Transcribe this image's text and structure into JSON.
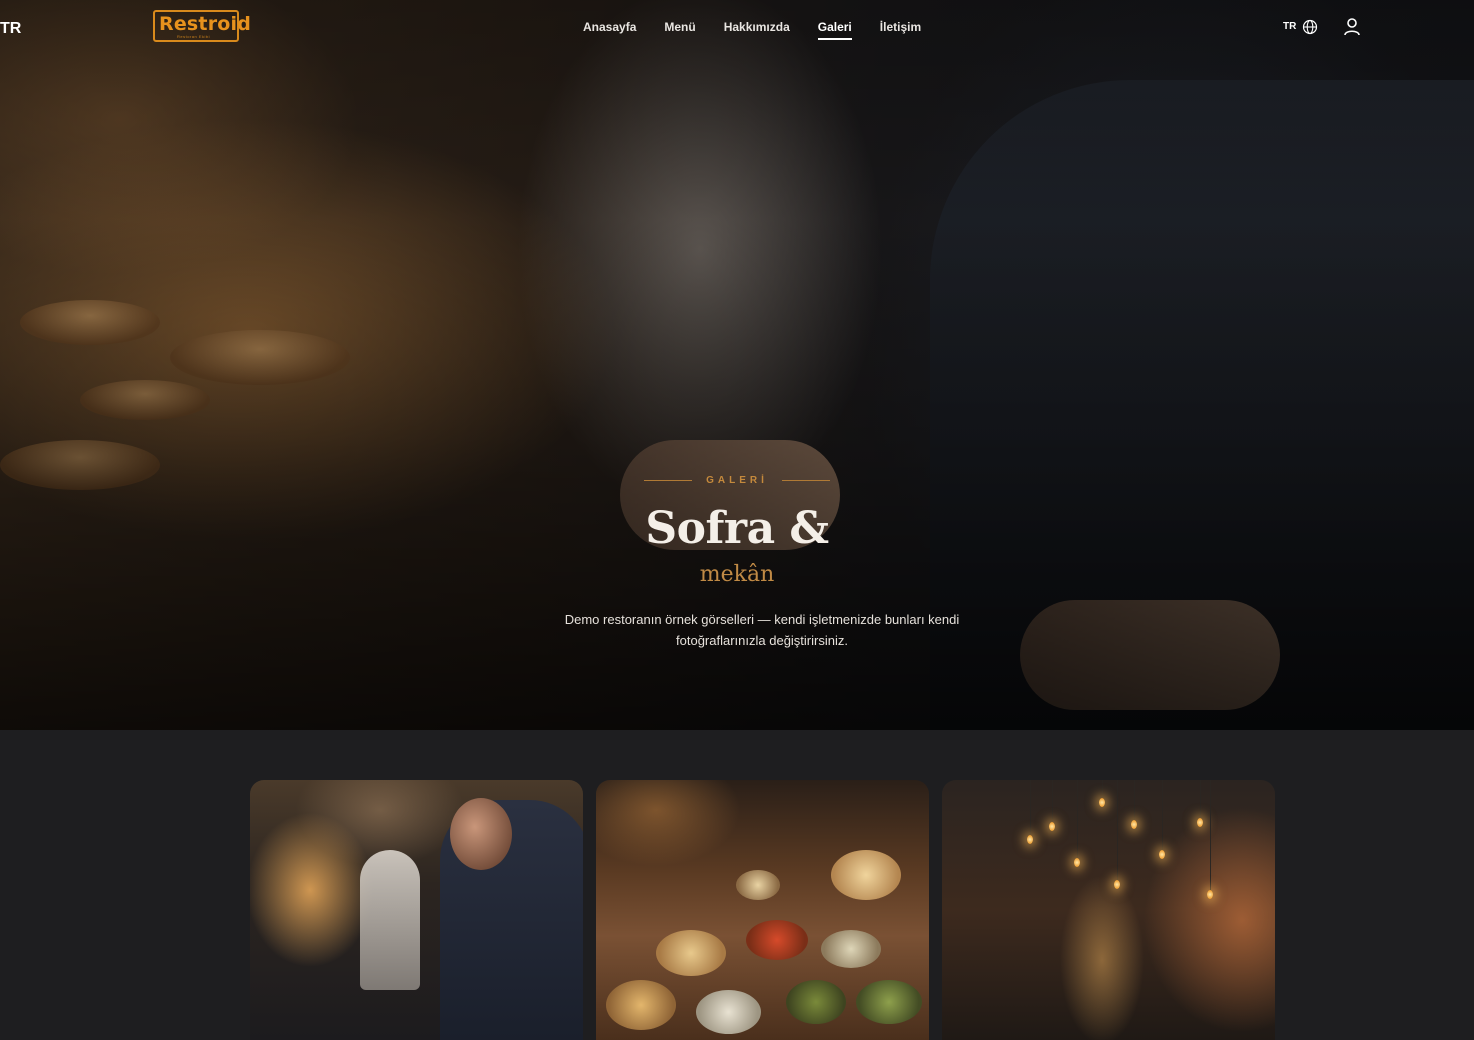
{
  "brand": {
    "name": "Restroid",
    "tagline": "Restoran Ekibi"
  },
  "nav": {
    "items": [
      {
        "label": "Anasayfa",
        "active": false
      },
      {
        "label": "Menü",
        "active": false
      },
      {
        "label": "Hakkımızda",
        "active": false
      },
      {
        "label": "Galeri",
        "active": true
      },
      {
        "label": "İletişim",
        "active": false
      }
    ],
    "lang_flag": "TR",
    "lang_label": "TR",
    "globe_icon": "globe-icon",
    "user_icon": "user-icon"
  },
  "hero": {
    "eyebrow": "GALERİ",
    "title": "Sofra &",
    "subtitle": "mekân",
    "description": "Demo restoranın örnek görselleri — kendi işletmenizde bunları kendi fotoğraflarınızla değiştirirsiniz."
  },
  "gallery": {
    "items": [
      {
        "alt": "kitchen-chef-photo"
      },
      {
        "alt": "table-meze-photo"
      },
      {
        "alt": "restaurant-interior-photo"
      }
    ]
  },
  "colors": {
    "accent": "#c4893c",
    "brand": "#e7921d",
    "background": "#1e1e20"
  }
}
